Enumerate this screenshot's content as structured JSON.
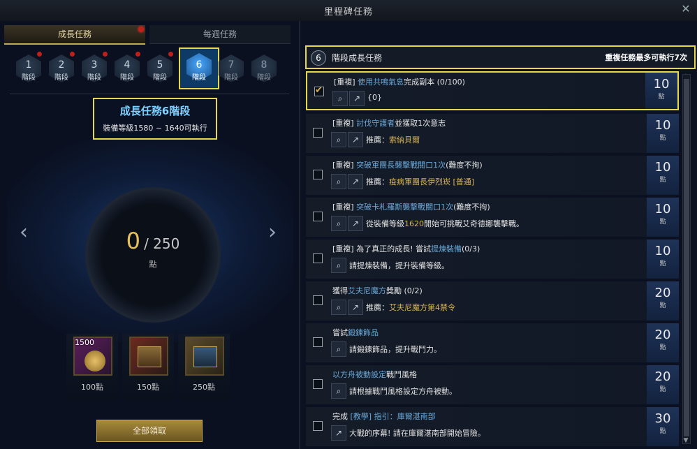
{
  "window": {
    "title": "里程碑任務",
    "close": "✕"
  },
  "tabs": [
    {
      "label": "成長任務"
    },
    {
      "label": "每週任務"
    }
  ],
  "stages": [
    {
      "num": "1",
      "label": "階段"
    },
    {
      "num": "2",
      "label": "階段"
    },
    {
      "num": "3",
      "label": "階段"
    },
    {
      "num": "4",
      "label": "階段"
    },
    {
      "num": "5",
      "label": "階段"
    },
    {
      "num": "6",
      "label": "階段"
    },
    {
      "num": "7",
      "label": "階段"
    },
    {
      "num": "8",
      "label": "階段"
    }
  ],
  "info": {
    "heading": "成長任務6階段",
    "sub": "裝備等級1580 ~ 1640可執行"
  },
  "progress": {
    "current": "0",
    "total": "/ 250",
    "unit": "點"
  },
  "rewards": [
    {
      "qty": "1500",
      "points": "100點"
    },
    {
      "qty": "",
      "points": "150點"
    },
    {
      "qty": "",
      "points": "250點"
    }
  ],
  "claim_all": "全部領取",
  "panel": {
    "badge": "6",
    "title": "階段成長任務",
    "repeat_note": "重複任務最多可執行7次"
  },
  "quests": [
    {
      "pre": "[重複] ",
      "blue": "使用共鳴氣息",
      "post": "完成副本 (0/100)",
      "sub_pre": "{0}",
      "sub_gold": "",
      "sub_post": "",
      "value": "10",
      "unit": "點",
      "checked": true
    },
    {
      "pre": "[重複] ",
      "blue": "討伐守護者",
      "post": "並獲取1次意志",
      "sub_pre": "推薦：",
      "sub_gold": "索納貝爾",
      "sub_post": "",
      "value": "10",
      "unit": "點",
      "checked": false
    },
    {
      "pre": "[重複] ",
      "blue": "突破軍團長襲擊戰關口1次",
      "post": "(難度不拘)",
      "sub_pre": "推薦：",
      "sub_gold": "疫病軍團長伊烈崁 [普通]",
      "sub_post": "",
      "value": "10",
      "unit": "點",
      "checked": false
    },
    {
      "pre": "[重複] ",
      "blue": "突破卡札羅斯襲擊戰關口1次",
      "post": "(難度不拘)",
      "sub_pre": "從裝備等級",
      "sub_gold": "1620",
      "sub_post": "開始可挑戰艾奇德娜襲擊戰。",
      "value": "10",
      "unit": "點",
      "checked": false
    },
    {
      "pre": "[重複] 為了真正的成長! 嘗試",
      "blue": "提煉裝備",
      "post": "(0/3)",
      "sub_pre": "請提煉裝備，提升裝備等級。",
      "sub_gold": "",
      "sub_post": "",
      "value": "10",
      "unit": "點",
      "checked": false
    },
    {
      "pre": "獲得",
      "blue": "艾夫尼魔方",
      "post": "獎勵 (0/2)",
      "sub_pre": "推薦：",
      "sub_gold": "艾夫尼魔方第4禁令",
      "sub_post": "",
      "value": "20",
      "unit": "點",
      "checked": false
    },
    {
      "pre": "嘗試",
      "blue": "鍛鍊飾品",
      "post": "",
      "sub_pre": "請鍛鍊飾品，提升戰鬥力。",
      "sub_gold": "",
      "sub_post": "",
      "value": "20",
      "unit": "點",
      "checked": false
    },
    {
      "pre": "",
      "blue": "以方舟被動設定",
      "post": "戰鬥風格",
      "sub_pre": "請根據戰鬥風格設定方舟被動。",
      "sub_gold": "",
      "sub_post": "",
      "value": "20",
      "unit": "點",
      "checked": false
    },
    {
      "pre": "完成 ",
      "blue": "[教學] 指引：庫爾湛南部",
      "post": "",
      "sub_pre": "大戰的序幕! 請在庫爾湛南部開始冒險。",
      "sub_gold": "",
      "sub_post": "",
      "value": "30",
      "unit": "點",
      "checked": false
    }
  ]
}
